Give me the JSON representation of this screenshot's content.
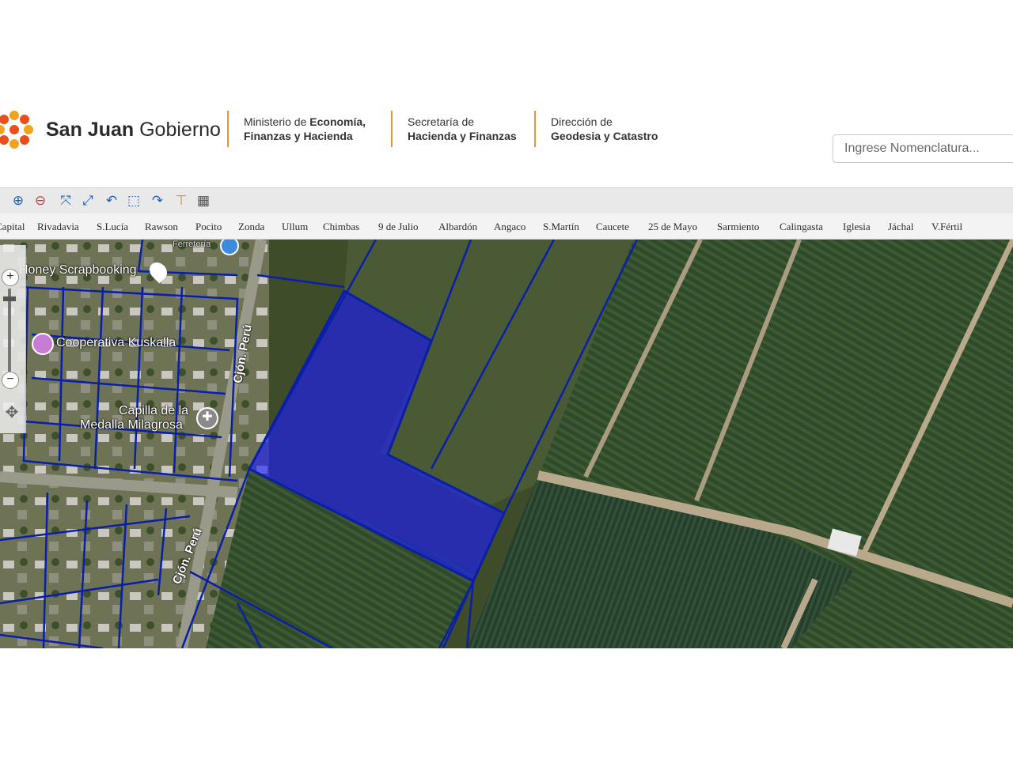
{
  "header": {
    "brand_bold": "San Juan",
    "brand_light": "Gobierno",
    "org1_line1_plain": "Ministerio de ",
    "org1_line1_bold": "Economía,",
    "org1_line2": "Finanzas y Hacienda",
    "org2_line1": "Secretaría  de",
    "org2_line2": "Hacienda y Finanzas",
    "org3_line1": "Dirección de",
    "org3_line2": "Geodesia y Catastro",
    "accent_color": "#f0922d"
  },
  "search": {
    "placeholder": "Ingrese Nomenclatura..."
  },
  "toolbar": {
    "icons": [
      "zoom-in-icon",
      "zoom-out-icon",
      "full-extent-icon",
      "fit-extent-icon",
      "undo-icon",
      "select-icon",
      "redo-icon",
      "measure-icon",
      "grid-icon"
    ]
  },
  "departments": [
    "Capital",
    "Rivadavia",
    "S.Lucía",
    "Rawson",
    "Pocito",
    "Zonda",
    "Ullum",
    "Chimbas",
    "9 de Julio",
    "Albardón",
    "Angaco",
    "S.Martín",
    "Caucete",
    "25 de Mayo",
    "Sarmiento",
    "Calingasta",
    "Iglesia",
    "Jáchal",
    "V.Fértil"
  ],
  "map": {
    "pois": [
      "Honey Scrapbooking",
      "Cooperativa Kuskalla",
      "Capilla de la",
      "Medalla Milagrosa",
      "Ferretería"
    ],
    "roads": [
      "Cjón. Perú",
      "Cjón. Perú"
    ],
    "highlight_color": "#1a1aff",
    "parcel_line_color": "#0a1fa8"
  }
}
